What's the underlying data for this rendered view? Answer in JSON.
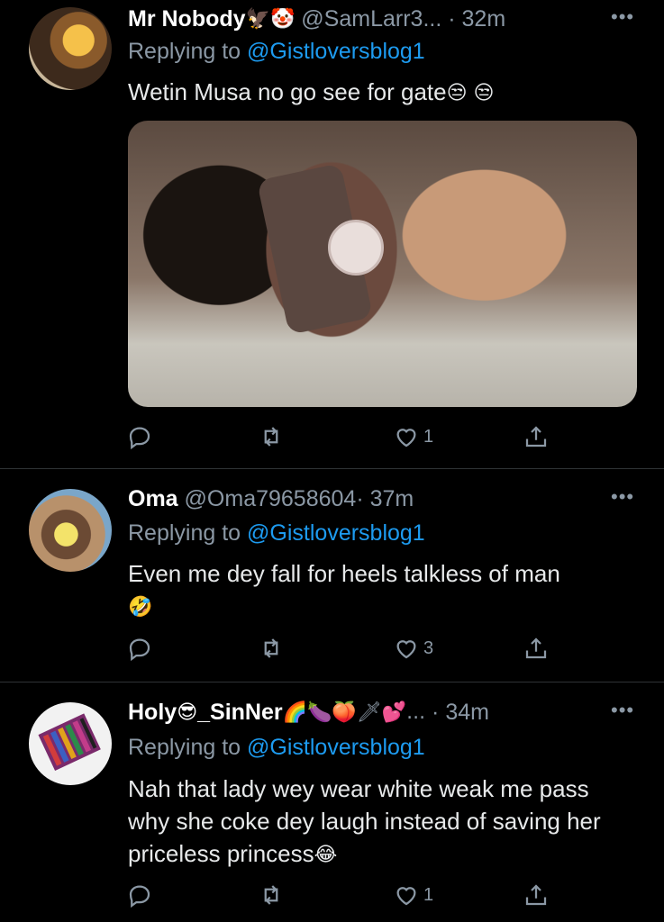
{
  "tweets": [
    {
      "name": "Mr Nobody",
      "name_emojis": "🦅🤡",
      "handle": "@SamLarr3...",
      "time": "· 32m",
      "replying_prefix": "Replying to",
      "replying_to": "@Gistloversblog1",
      "text": "Wetin Musa no go see for gate",
      "text_emojis": "😒 😒",
      "likes": "1"
    },
    {
      "name": "Oma",
      "name_emojis": "",
      "handle": "@Oma79658604",
      "time": "· 37m",
      "replying_prefix": "Replying to",
      "replying_to": "@Gistloversblog1",
      "text": "Even me dey fall for heels talkless of man",
      "text_emojis": "🤣",
      "likes": "3"
    },
    {
      "name": "Holy",
      "name_emoji_mid": "😎",
      "name_rest": "_SinNer",
      "name_emojis": "🌈🍆🍑🗡💕...",
      "handle": "",
      "time": "· 34m",
      "replying_prefix": "Replying to",
      "replying_to": "@Gistloversblog1",
      "text": "Nah that lady wey wear white weak me pass why she coke dey laugh instead of saving her priceless princess",
      "text_emojis": "😂",
      "likes": "1"
    }
  ],
  "icons": {
    "reply": "reply-icon",
    "retweet": "retweet-icon",
    "like": "heart-icon",
    "share": "share-icon",
    "more": "more-icon"
  },
  "colors": {
    "background": "#000000",
    "text": "#e7e9ea",
    "muted": "#8b98a5",
    "mention": "#1d9bf0",
    "divider": "#2f3336"
  }
}
